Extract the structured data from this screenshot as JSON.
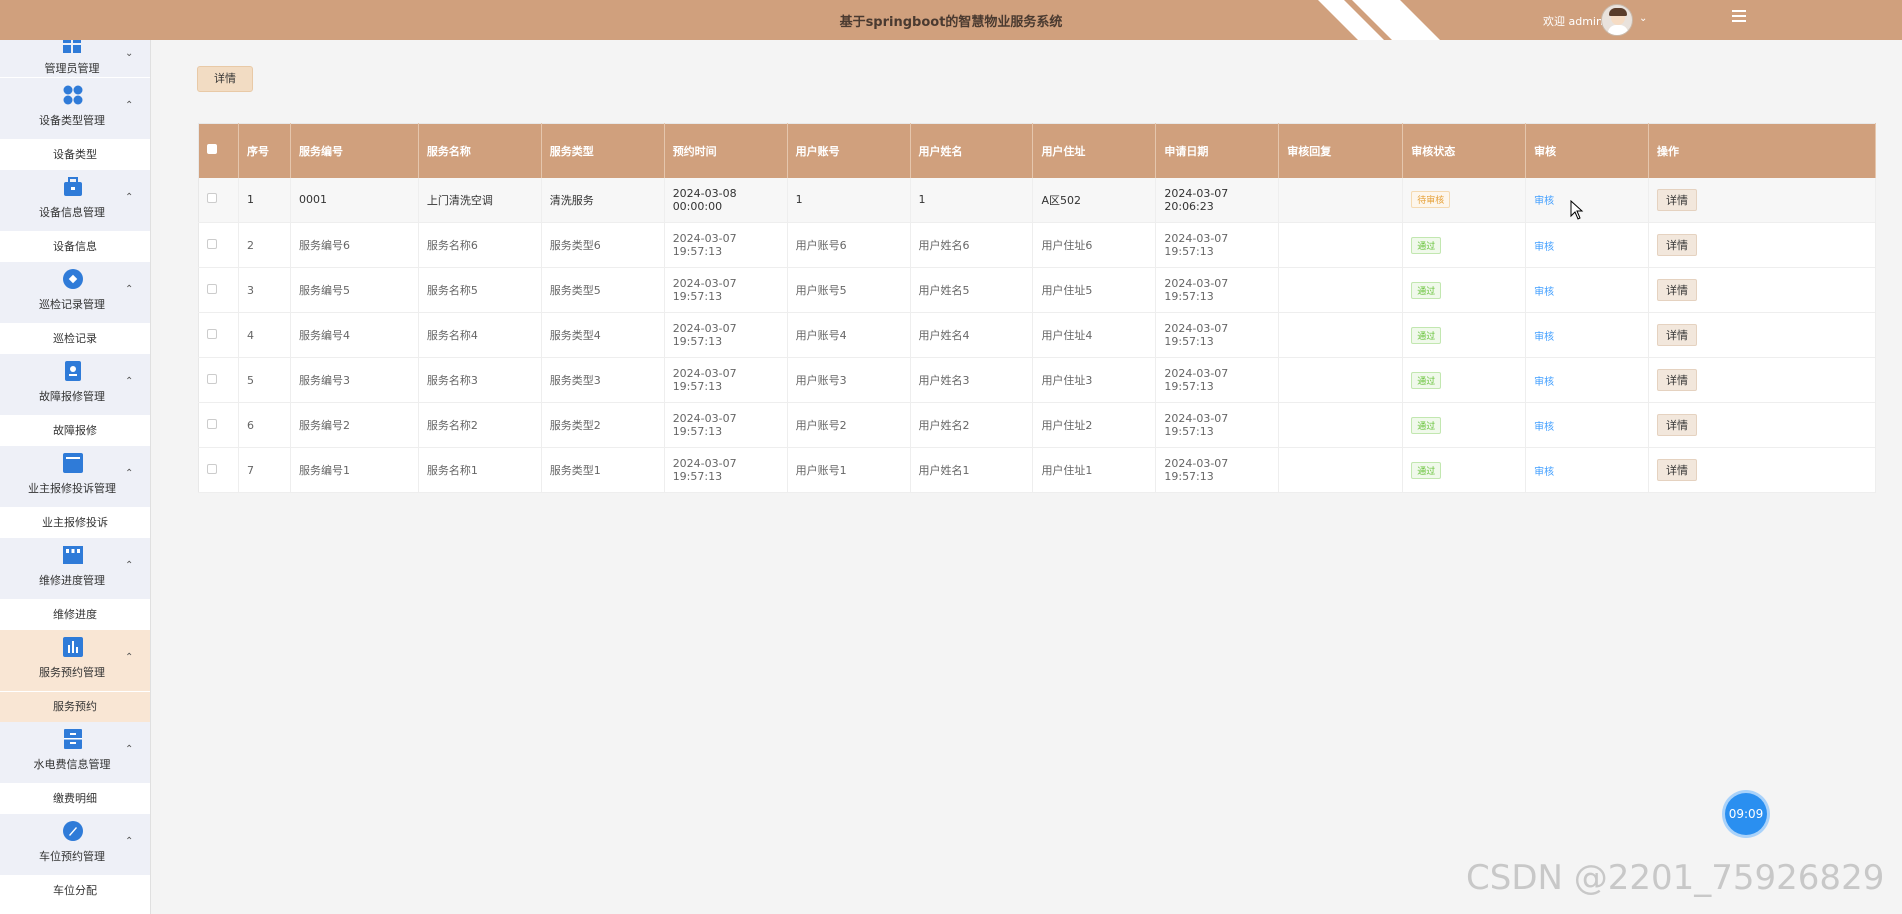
{
  "header": {
    "title": "基于springboot的智慧物业服务系统",
    "welcome": "欢迎 admin",
    "caret": "⌄"
  },
  "sidebar": {
    "groups": [
      {
        "label": "管理员管理",
        "icon": "grid-icon",
        "sub": null
      },
      {
        "label": "设备类型管理",
        "icon": "apps-icon",
        "sub": "设备类型"
      },
      {
        "label": "设备信息管理",
        "icon": "briefcase-icon",
        "sub": "设备信息"
      },
      {
        "label": "巡检记录管理",
        "icon": "diamond-icon",
        "sub": "巡检记录"
      },
      {
        "label": "故障报修管理",
        "icon": "repair-icon",
        "sub": "故障报修"
      },
      {
        "label": "业主报修投诉管理",
        "icon": "complaint-icon",
        "sub": "业主报修投诉"
      },
      {
        "label": "维修进度管理",
        "icon": "store-icon",
        "sub": "维修进度"
      },
      {
        "label": "服务预约管理",
        "icon": "chart-icon",
        "sub": "服务预约"
      },
      {
        "label": "水电费信息管理",
        "icon": "cabinet-icon",
        "sub": "缴费明细"
      },
      {
        "label": "车位预约管理",
        "icon": "compass-icon",
        "sub": "车位分配"
      }
    ]
  },
  "toolbar": {
    "detail_label": "详情"
  },
  "table": {
    "headers": [
      "",
      "序号",
      "服务编号",
      "服务名称",
      "服务类型",
      "预约时间",
      "用户账号",
      "用户姓名",
      "用户住址",
      "申请日期",
      "审核回复",
      "审核状态",
      "审核",
      "操作"
    ],
    "rows": [
      {
        "idx": "1",
        "code": "0001",
        "name": "上门清洗空调",
        "type": "清洗服务",
        "time": "2024-03-08 00:00:00",
        "account": "1",
        "uname": "1",
        "addr": "A区502",
        "date": "2024-03-07 20:06:23",
        "reply": "",
        "status": "待审核",
        "audit": "审核",
        "op": "详情"
      },
      {
        "idx": "2",
        "code": "服务编号6",
        "name": "服务名称6",
        "type": "服务类型6",
        "time": "2024-03-07 19:57:13",
        "account": "用户账号6",
        "uname": "用户姓名6",
        "addr": "用户住址6",
        "date": "2024-03-07 19:57:13",
        "reply": "",
        "status": "通过",
        "audit": "审核",
        "op": "详情"
      },
      {
        "idx": "3",
        "code": "服务编号5",
        "name": "服务名称5",
        "type": "服务类型5",
        "time": "2024-03-07 19:57:13",
        "account": "用户账号5",
        "uname": "用户姓名5",
        "addr": "用户住址5",
        "date": "2024-03-07 19:57:13",
        "reply": "",
        "status": "通过",
        "audit": "审核",
        "op": "详情"
      },
      {
        "idx": "4",
        "code": "服务编号4",
        "name": "服务名称4",
        "type": "服务类型4",
        "time": "2024-03-07 19:57:13",
        "account": "用户账号4",
        "uname": "用户姓名4",
        "addr": "用户住址4",
        "date": "2024-03-07 19:57:13",
        "reply": "",
        "status": "通过",
        "audit": "审核",
        "op": "详情"
      },
      {
        "idx": "5",
        "code": "服务编号3",
        "name": "服务名称3",
        "type": "服务类型3",
        "time": "2024-03-07 19:57:13",
        "account": "用户账号3",
        "uname": "用户姓名3",
        "addr": "用户住址3",
        "date": "2024-03-07 19:57:13",
        "reply": "",
        "status": "通过",
        "audit": "审核",
        "op": "详情"
      },
      {
        "idx": "6",
        "code": "服务编号2",
        "name": "服务名称2",
        "type": "服务类型2",
        "time": "2024-03-07 19:57:13",
        "account": "用户账号2",
        "uname": "用户姓名2",
        "addr": "用户住址2",
        "date": "2024-03-07 19:57:13",
        "reply": "",
        "status": "通过",
        "audit": "审核",
        "op": "详情"
      },
      {
        "idx": "7",
        "code": "服务编号1",
        "name": "服务名称1",
        "type": "服务类型1",
        "time": "2024-03-07 19:57:13",
        "account": "用户账号1",
        "uname": "用户姓名1",
        "addr": "用户住址1",
        "date": "2024-03-07 19:57:13",
        "reply": "",
        "status": "通过",
        "audit": "审核",
        "op": "详情"
      }
    ]
  },
  "clock": {
    "time": "09:09"
  },
  "watermark": "CSDN @2201_75926829",
  "colors": {
    "header": "#d0a07d",
    "accent": "#2f7bd8",
    "pending": "#e6a23c",
    "pass": "#67c23a"
  }
}
